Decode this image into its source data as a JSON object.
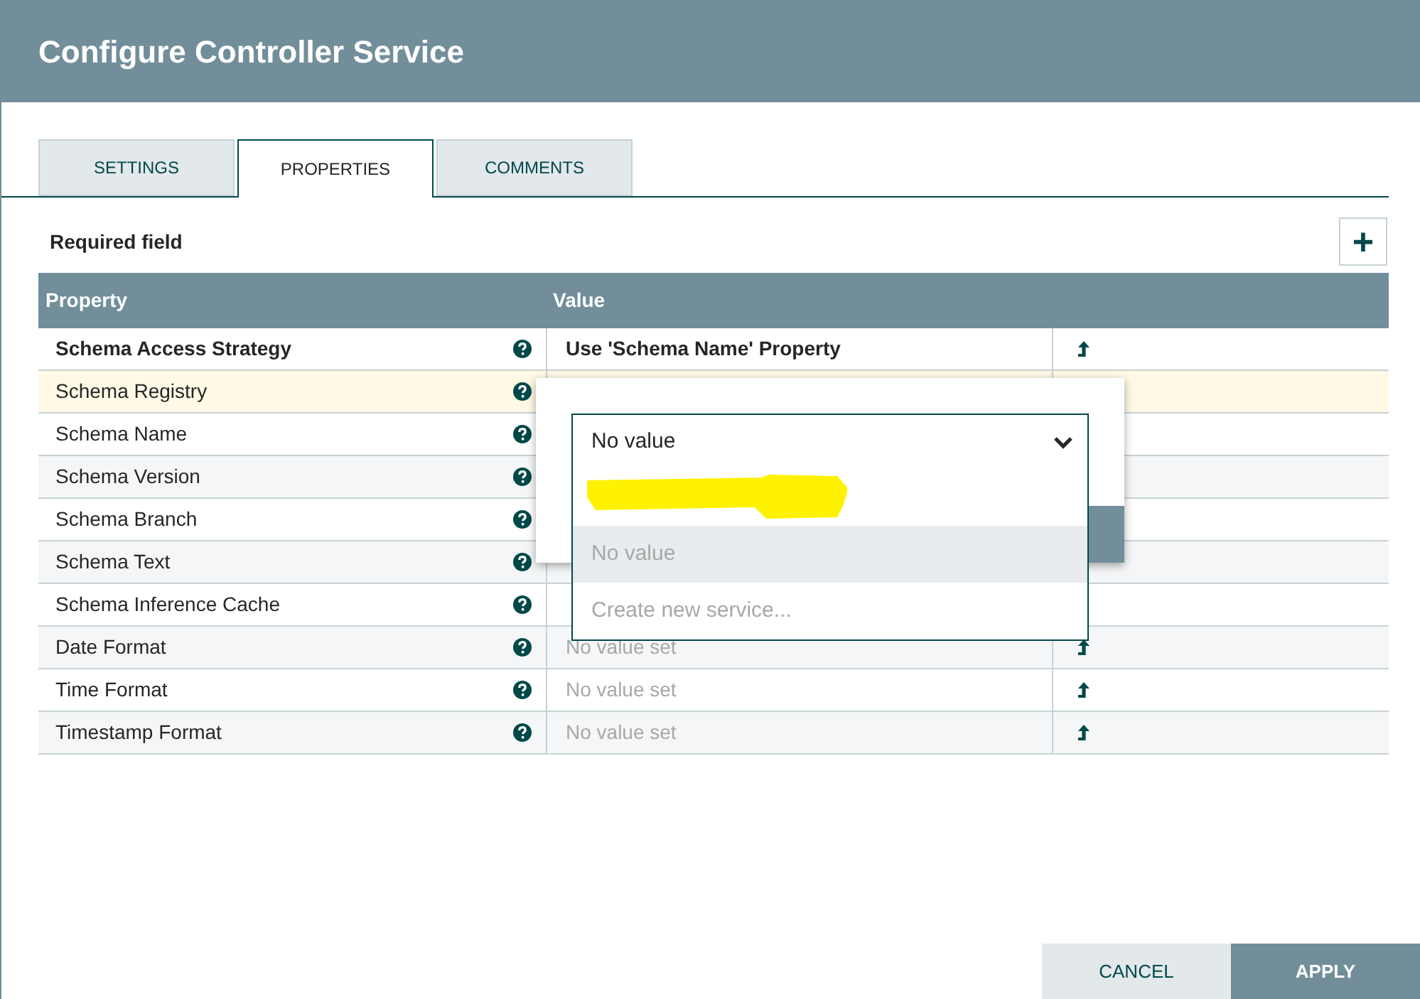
{
  "window": {
    "title": "Configure Controller Service"
  },
  "tabs": [
    {
      "label": "SETTINGS",
      "selected": false
    },
    {
      "label": "PROPERTIES",
      "selected": true
    },
    {
      "label": "COMMENTS",
      "selected": false
    }
  ],
  "required_label": "Required field",
  "add_button": {
    "label": "+"
  },
  "table": {
    "columns": [
      "Property",
      "Value"
    ],
    "rows": [
      {
        "name": "Schema Access Strategy",
        "required": true,
        "selected": false,
        "value": "Use 'Schema Name' Property",
        "value_set": true,
        "goto": true
      },
      {
        "name": "Schema Registry",
        "required": false,
        "selected": true,
        "goto": false
      },
      {
        "name": "Schema Name",
        "required": false,
        "selected": false,
        "goto": false
      },
      {
        "name": "Schema Version",
        "required": false,
        "selected": false,
        "goto": false
      },
      {
        "name": "Schema Branch",
        "required": false,
        "selected": false,
        "goto": false
      },
      {
        "name": "Schema Text",
        "required": false,
        "selected": false,
        "goto": false
      },
      {
        "name": "Schema Inference Cache",
        "required": false,
        "selected": false,
        "goto": false
      },
      {
        "name": "Date Format",
        "required": false,
        "selected": false,
        "value": "No value set",
        "value_set": false,
        "goto": true
      },
      {
        "name": "Time Format",
        "required": false,
        "selected": false,
        "value": "No value set",
        "value_set": false,
        "goto": true
      },
      {
        "name": "Timestamp Format",
        "required": false,
        "selected": false,
        "value": "No value set",
        "value_set": false,
        "goto": true
      }
    ]
  },
  "editor": {
    "combo": {
      "value": "No value",
      "expanded": true,
      "options": [
        {
          "kind": "redacted",
          "selected": false
        },
        {
          "kind": "option",
          "label": "No value",
          "selected": true
        },
        {
          "kind": "option",
          "label": "Create new service...",
          "selected": false
        }
      ]
    }
  },
  "buttons": [
    {
      "label": "CANCEL",
      "kind": "secondary"
    },
    {
      "label": "APPLY",
      "kind": "primary"
    }
  ]
}
